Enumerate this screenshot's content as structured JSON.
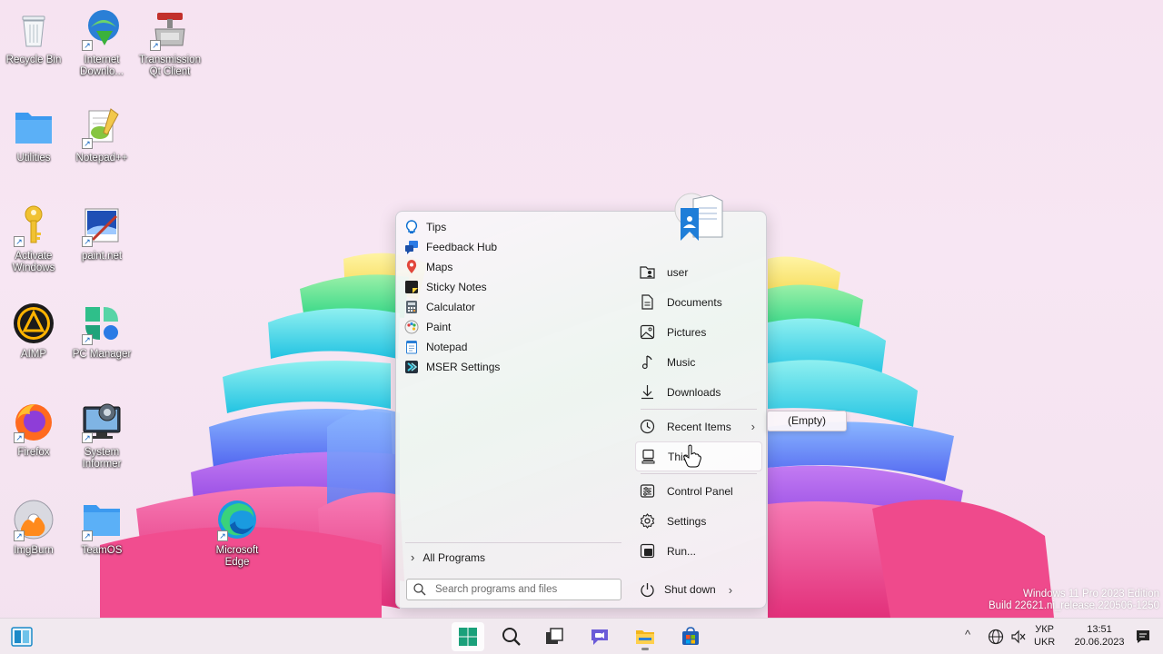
{
  "desktop": {
    "icons": [
      {
        "label": "Recycle Bin",
        "icon": "recycle-bin-icon"
      },
      {
        "label": "Internet Downlo...",
        "icon": "idm-icon"
      },
      {
        "label": "Transmission Qt Client",
        "icon": "transmission-icon"
      },
      {
        "label": "Utilities",
        "icon": "folder-icon"
      },
      {
        "label": "Notepad++",
        "icon": "notepadpp-icon"
      },
      {
        "label": "Activate Windows",
        "icon": "key-icon"
      },
      {
        "label": "paint.net",
        "icon": "paintnet-icon"
      },
      {
        "label": "AIMP",
        "icon": "aimp-icon"
      },
      {
        "label": "PC Manager",
        "icon": "pc-manager-icon"
      },
      {
        "label": "Firefox",
        "icon": "firefox-icon"
      },
      {
        "label": "System Informer",
        "icon": "system-informer-icon"
      },
      {
        "label": "ImgBurn",
        "icon": "imgburn-icon"
      },
      {
        "label": "TeamOS",
        "icon": "folder-icon"
      },
      {
        "label": "Microsoft Edge",
        "icon": "edge-icon"
      }
    ]
  },
  "start_menu": {
    "programs": [
      {
        "label": "Tips",
        "icon": "tips-icon"
      },
      {
        "label": "Feedback Hub",
        "icon": "feedback-hub-icon"
      },
      {
        "label": "Maps",
        "icon": "maps-icon"
      },
      {
        "label": "Sticky Notes",
        "icon": "sticky-notes-icon"
      },
      {
        "label": "Calculator",
        "icon": "calculator-icon"
      },
      {
        "label": "Paint",
        "icon": "paint-icon"
      },
      {
        "label": "Notepad",
        "icon": "notepad-icon"
      },
      {
        "label": "MSER Settings",
        "icon": "mser-settings-icon"
      }
    ],
    "all_programs_label": "All Programs",
    "search_placeholder": "Search programs and files",
    "places": {
      "user": "user",
      "documents": "Documents",
      "pictures": "Pictures",
      "music": "Music",
      "downloads": "Downloads",
      "recent_items": "Recent Items",
      "this_pc": "This",
      "control_panel": "Control Panel",
      "settings": "Settings",
      "run": "Run..."
    },
    "shutdown_label": "Shut down",
    "recent_flyout": "(Empty)"
  },
  "watermark": {
    "line1": "Windows 11 Pro 2023 Edition",
    "line2": "Build 22621.ni_release.220506-1250"
  },
  "taskbar": {
    "apps": [
      "start-button",
      "search-button",
      "task-view-button",
      "chat-button",
      "file-explorer-button",
      "store-button"
    ],
    "language": {
      "line1": "УКР",
      "line2": "UKR"
    },
    "clock": {
      "time": "13:51",
      "date": "20.06.2023"
    }
  },
  "colors": {
    "accent": "#0067c0",
    "taskbar_bg": "#f1e9ef",
    "menu_bg": "#f5f1f5"
  }
}
